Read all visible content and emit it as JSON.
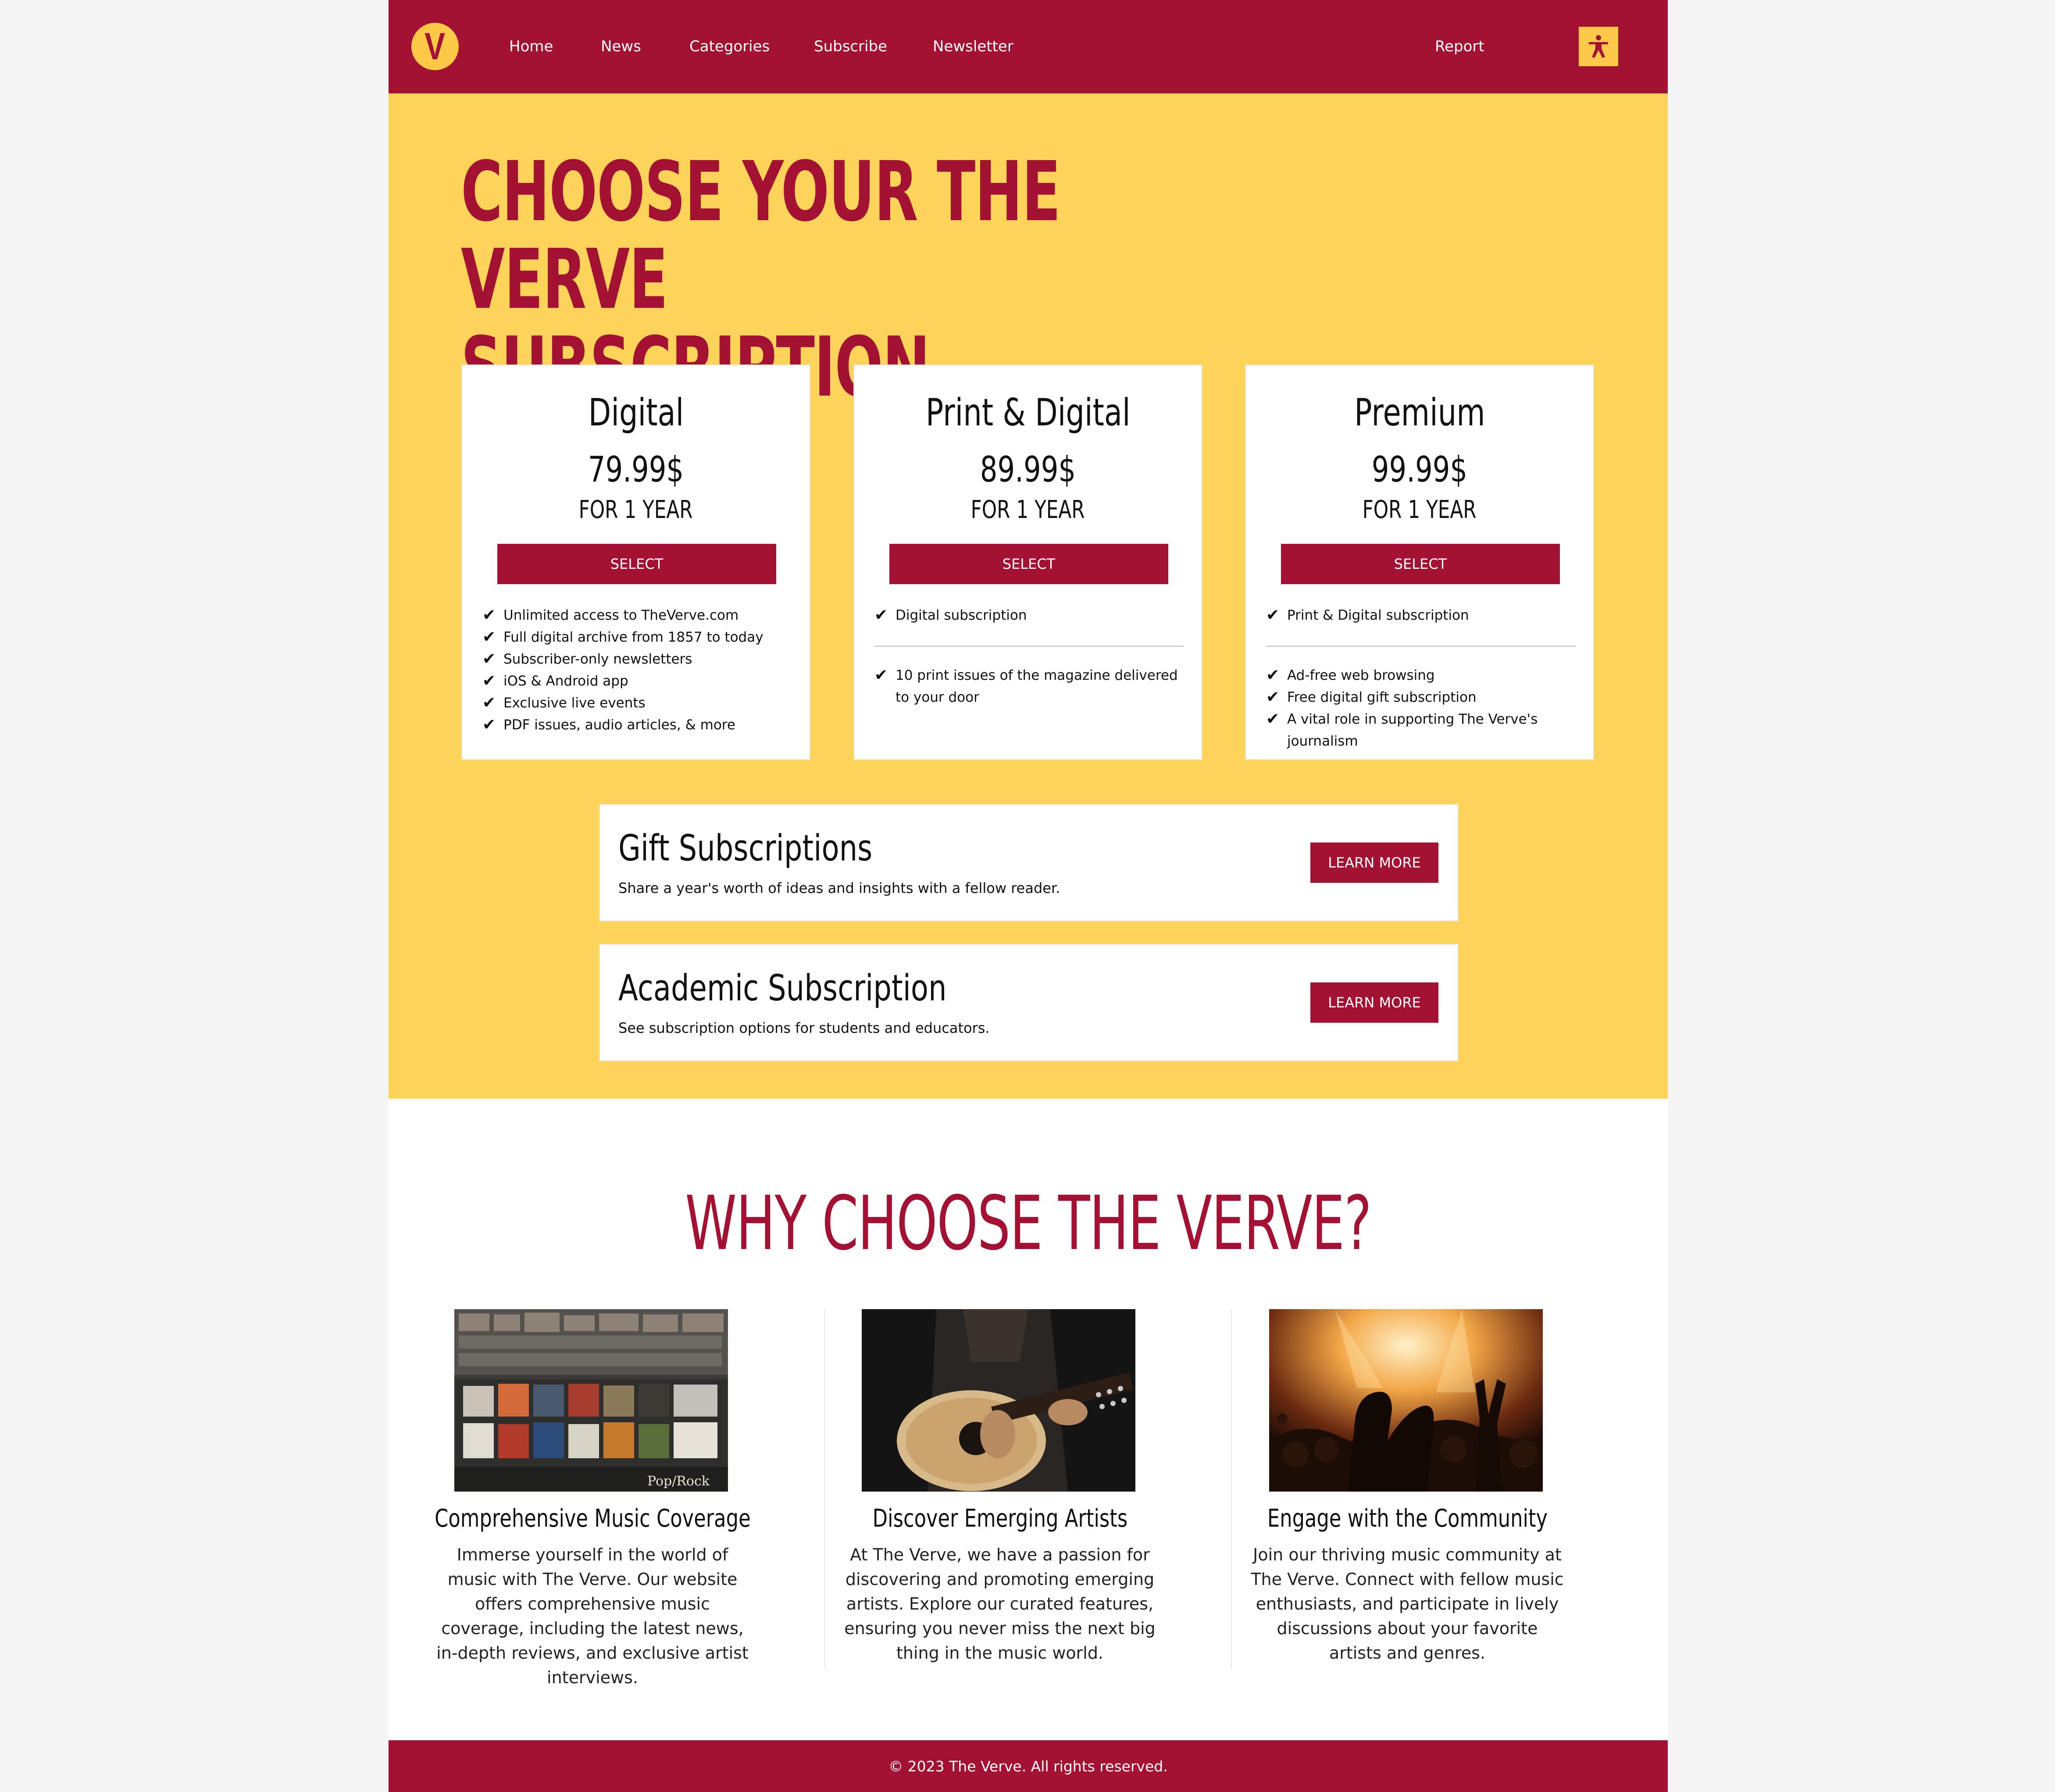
{
  "nav": {
    "logo_letter": "V",
    "items": [
      "Home",
      "News",
      "Categories",
      "Subscribe",
      "Newsletter"
    ],
    "report": "Report",
    "accessibility_icon": "accessibility-person-icon"
  },
  "hero": {
    "title": "CHOOSE YOUR THE VERVE SUBSCRIPTION",
    "plans": [
      {
        "name": "Digital",
        "price": "79.99$",
        "period": "FOR 1 YEAR",
        "button": "SELECT",
        "features": [
          "Unlimited access to TheVerve.com",
          "Full digital archive from 1857 to today",
          "Subscriber-only newsletters",
          "iOS & Android app",
          "Exclusive live events",
          "PDF issues, audio articles, & more"
        ]
      },
      {
        "name": "Print & Digital",
        "price": "89.99$",
        "period": "FOR 1 YEAR",
        "button": "SELECT",
        "features": [
          "Digital subscription"
        ],
        "extra_features": [
          "10 print issues of the magazine delivered to your door"
        ]
      },
      {
        "name": "Premium",
        "price": "99.99$",
        "period": "FOR 1 YEAR",
        "button": "SELECT",
        "features": [
          "Print & Digital subscription"
        ],
        "extra_features": [
          "Ad-free web browsing",
          "Free digital gift subscription",
          "A vital role in supporting The Verve's journalism"
        ]
      }
    ],
    "promos": [
      {
        "title": "Gift Subscriptions",
        "description": "Share a year's worth of ideas and insights with a fellow reader.",
        "button": "LEARN MORE"
      },
      {
        "title": "Academic Subscription",
        "description": "See subscription options for students and educators.",
        "button": "LEARN MORE"
      }
    ]
  },
  "why": {
    "title": "WHY CHOOSE THE VERVE?",
    "items": [
      {
        "heading": "Comprehensive Music Coverage",
        "text": "Immerse yourself in the world of music with The Verve. Our website offers comprehensive music coverage, including the latest news, in-depth reviews, and exclusive artist interviews.",
        "image_sign": "Pop/Rock"
      },
      {
        "heading": "Discover Emerging Artists",
        "text": "At The Verve, we have a passion for discovering and promoting emerging artists. Explore our curated features, ensuring you never miss the next big thing in the music world."
      },
      {
        "heading": "Engage with the Community",
        "text": "Join our thriving music community at The Verve. Connect with fellow music enthusiasts, and participate in lively discussions about your favorite artists and genres."
      }
    ]
  },
  "footer": {
    "text": "© 2023 The Verve. All rights reserved."
  },
  "colors": {
    "brand_red": "#a31133",
    "hero_yellow": "#fdd35a",
    "logo_yellow": "#ffc947"
  }
}
